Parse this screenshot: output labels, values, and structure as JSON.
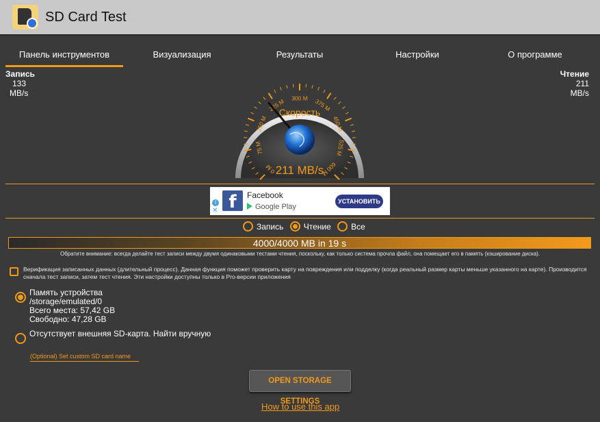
{
  "app": {
    "title": "SD Card Test"
  },
  "tabs": [
    {
      "label": "Панель инструментов",
      "active": true
    },
    {
      "label": "Визуализация",
      "active": false
    },
    {
      "label": "Результаты",
      "active": false
    },
    {
      "label": "Настройки",
      "active": false
    },
    {
      "label": "О программе",
      "active": false
    }
  ],
  "write": {
    "label": "Запись",
    "value": "133",
    "unit": "MB/s"
  },
  "read": {
    "label": "Чтение",
    "value": "211",
    "unit": "MB/s"
  },
  "gauge": {
    "caption": "Скорость",
    "readout": "211 MB/s",
    "ticks": [
      "0 M",
      "75 M",
      "150 M",
      "225 M",
      "300 M",
      "375 M",
      "450 M",
      "525 M",
      "600 M"
    ],
    "value": 211,
    "max": 600
  },
  "ad": {
    "name": "Facebook",
    "store": "Google Play",
    "button": "УСТАНОВИТЬ",
    "logo_letter": "f",
    "info": "i",
    "close": "✕"
  },
  "mode": {
    "options": [
      {
        "label": "Запись",
        "checked": false
      },
      {
        "label": "Чтение",
        "checked": true
      },
      {
        "label": "Все",
        "checked": false
      }
    ]
  },
  "progress": {
    "text": "4000/4000 MB in 19 s",
    "fraction": 1.0
  },
  "note": "Обратите внимание: всегда делайте тест записи между двумя одинаковыми тестами чтения, поскольку, как только система прочла файл, она помещает его в память (кэширование диска).",
  "verify": {
    "checked": false,
    "text": "Верификация записанных данных (длительный процесс). Данная функция поможет проверить карту на повреждения или подделку (когда реальный размер карты меньше указанного на карте). Производится сначала тест записи, затем тест чтения. Эти настройки доступны только в Pro-версии приложения"
  },
  "storage": {
    "internal": {
      "checked": true,
      "name": "Память устройства",
      "path": "/storage/emulated/0",
      "total": "Всего места: 57,42 GB",
      "free": "Свободно: 47,28 GB"
    },
    "external": {
      "checked": false,
      "name": "Отсутствует внешняя SD-карта. Найти вручную"
    }
  },
  "custom_name_label": "(Optional) Set custom SD card name",
  "open_settings_label": "OPEN STORAGE SETTINGS",
  "howto_label": "How to use this app",
  "colors": {
    "accent": "#f39a1b",
    "background": "#3a3a3a",
    "titlebar": "#c8c8c8"
  }
}
